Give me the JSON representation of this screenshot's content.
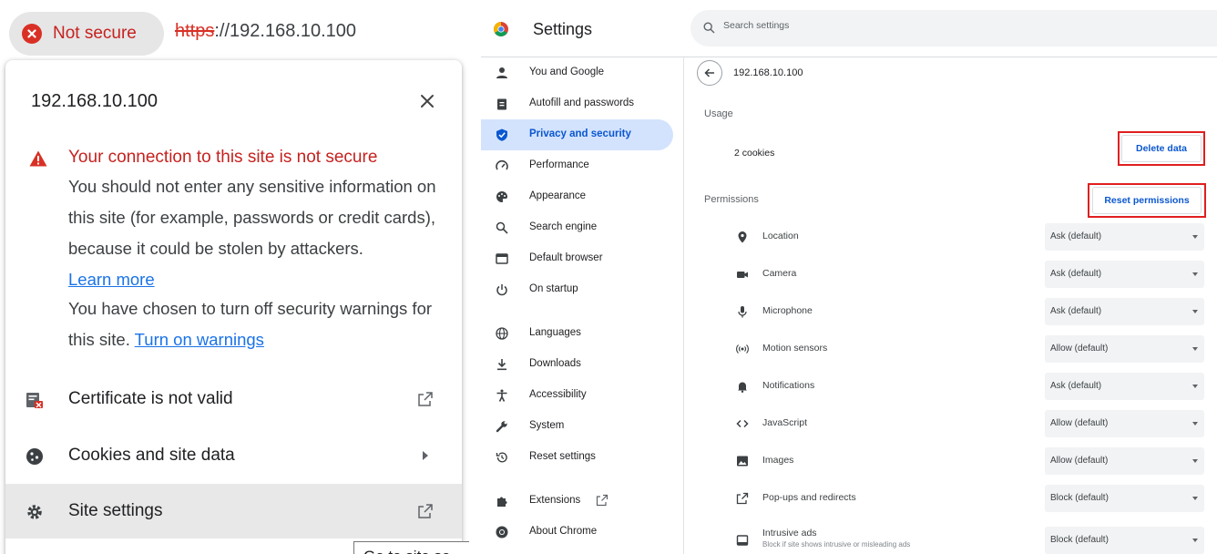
{
  "left_panel": {
    "address_bar": {
      "security_chip": "Not secure",
      "url_scheme": "https",
      "url_rest": "://192.168.10.100"
    },
    "popup": {
      "title": "192.168.10.100",
      "warning_title": "Your connection to this site is not secure",
      "warning_body": "You should not enter any sensitive information on this site (for example, passwords or credit cards), because it could be stolen by attackers.",
      "learn_more": "Learn more",
      "warnings_off_text": "You have chosen to turn off security warnings for this site.",
      "turn_on_warnings": "Turn on warnings",
      "rows": [
        {
          "label": "Certificate is not valid",
          "icon": "certificate-error-icon",
          "end_icon": "external-link-icon"
        },
        {
          "label": "Cookies and site data",
          "icon": "cookie-icon",
          "end_icon": "arrow-right-icon"
        },
        {
          "label": "Site settings",
          "icon": "gear-icon",
          "end_icon": "external-link-icon"
        }
      ]
    },
    "tooltip_fragment": "Go to site se"
  },
  "right_panel": {
    "app_title": "Settings",
    "search_placeholder": "Search settings",
    "sidebar": {
      "items": [
        {
          "label": "You and Google",
          "icon": "person-icon"
        },
        {
          "label": "Autofill and passwords",
          "icon": "clipboard-icon"
        },
        {
          "label": "Privacy and security",
          "icon": "shield-icon"
        },
        {
          "label": "Performance",
          "icon": "speedometer-icon"
        },
        {
          "label": "Appearance",
          "icon": "palette-icon"
        },
        {
          "label": "Search engine",
          "icon": "search-icon"
        },
        {
          "label": "Default browser",
          "icon": "browser-window-icon"
        },
        {
          "label": "On startup",
          "icon": "power-icon"
        },
        {
          "label": "Languages",
          "icon": "globe-icon"
        },
        {
          "label": "Downloads",
          "icon": "download-icon"
        },
        {
          "label": "Accessibility",
          "icon": "accessibility-icon"
        },
        {
          "label": "System",
          "icon": "wrench-icon"
        },
        {
          "label": "Reset settings",
          "icon": "history-icon"
        },
        {
          "label": "Extensions",
          "icon": "puzzle-icon"
        },
        {
          "label": "About Chrome",
          "icon": "chrome-icon"
        }
      ],
      "active_index": 2
    },
    "content": {
      "site": "192.168.10.100",
      "usage_heading": "Usage",
      "cookies_text": "2 cookies",
      "delete_data": "Delete data",
      "permissions_heading": "Permissions",
      "reset_permissions": "Reset permissions",
      "permissions": [
        {
          "label": "Location",
          "value": "Ask (default)",
          "icon": "location-pin-icon"
        },
        {
          "label": "Camera",
          "value": "Ask (default)",
          "icon": "camera-icon"
        },
        {
          "label": "Microphone",
          "value": "Ask (default)",
          "icon": "microphone-icon"
        },
        {
          "label": "Motion sensors",
          "value": "Allow (default)",
          "icon": "sensors-icon"
        },
        {
          "label": "Notifications",
          "value": "Ask (default)",
          "icon": "bell-icon"
        },
        {
          "label": "JavaScript",
          "value": "Allow (default)",
          "icon": "code-icon"
        },
        {
          "label": "Images",
          "value": "Allow (default)",
          "icon": "image-icon"
        },
        {
          "label": "Pop-ups and redirects",
          "value": "Block (default)",
          "icon": "external-link-icon"
        },
        {
          "label": "Intrusive ads",
          "sublabel": "Block if site shows intrusive or misleading ads",
          "value": "Block (default)",
          "icon": "ads-icon"
        }
      ]
    }
  },
  "colors": {
    "danger": "#d93025",
    "link": "#1a73e8",
    "accent": "#0b57d0",
    "nav_active_bg": "#d3e3fd",
    "highlight_box": "#e01f1f"
  }
}
